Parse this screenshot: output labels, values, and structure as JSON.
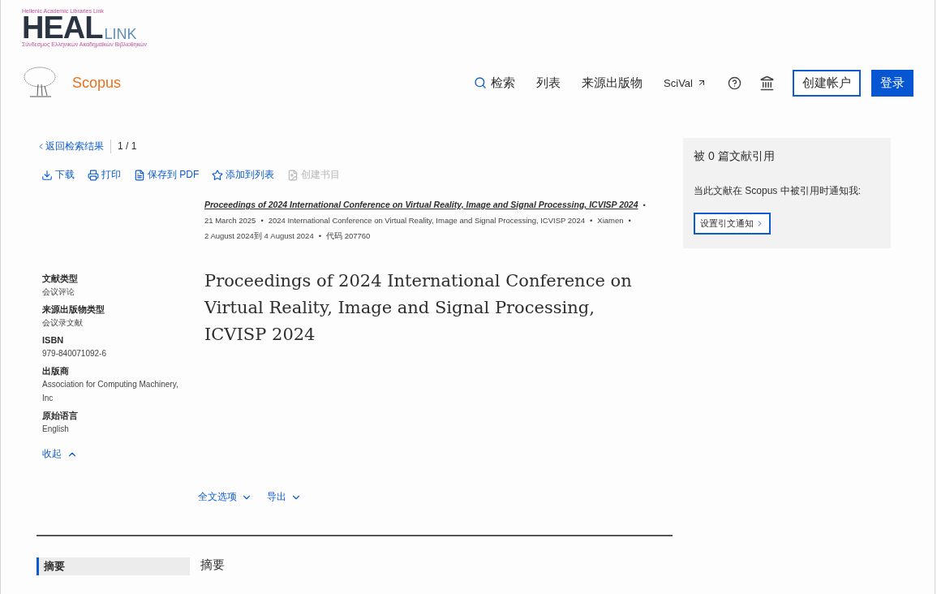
{
  "institution_logo": {
    "tagline": "Hellenic Academic Libraries Link",
    "wordmark": "HEAL",
    "suffix": "LINK",
    "subtitle": "Σύνδεσμος Ελληνικών Ακαδημαϊκών Βιβλιοθηκών"
  },
  "brand": {
    "name": "Scopus"
  },
  "nav": {
    "items": [
      {
        "label": "检索",
        "kind": "search"
      },
      {
        "label": "列表",
        "kind": "plain"
      },
      {
        "label": "来源出版物",
        "kind": "plain"
      },
      {
        "label": "SciVal",
        "kind": "external"
      }
    ],
    "create_account": "创建帐户",
    "sign_in": "登录"
  },
  "breadcrumb": {
    "back": "返回检索结果",
    "position": "1 / 1"
  },
  "toolbar": [
    {
      "label": "下载",
      "disabled": false
    },
    {
      "label": "打印",
      "disabled": false
    },
    {
      "label": "保存到 PDF",
      "disabled": false
    },
    {
      "label": "添加到列表",
      "disabled": false
    },
    {
      "label": "创建书目",
      "disabled": true
    }
  ],
  "source": {
    "title": "Proceedings of 2024 International Conference on Virtual Reality, Image and Signal Processing, ICVISP 2024",
    "separator": "•",
    "details": [
      "21 March 2025",
      "2024 International Conference on Virtual Reality, Image and Signal Processing, ICVISP 2024",
      "Xiamen",
      "2 August 2024到 4 August 2024",
      "代码 207760"
    ]
  },
  "metadata": [
    {
      "label": "文献类型",
      "value": "会议评论"
    },
    {
      "label": "来源出版物类型",
      "value": "会议录文献"
    },
    {
      "label": "ISBN",
      "value": "979-840071092-6"
    },
    {
      "label": "出版商",
      "value": "Association for Computing Machinery, Inc"
    },
    {
      "label": "原始语言",
      "value": "English"
    }
  ],
  "collapse": "收起",
  "document_title": "Proceedings of 2024 International Conference on Virtual Reality, Image and Signal Processing, ICVISP 2024",
  "actions": [
    "全文选项",
    "导出"
  ],
  "section_nav": [
    {
      "label": "摘要",
      "selected": true
    }
  ],
  "section_heading": "摘要",
  "citations": {
    "title": "被 0 篇文献引用",
    "note": "当此文献在 Scopus 中被引用时通知我:",
    "button": "设置引文通知"
  }
}
